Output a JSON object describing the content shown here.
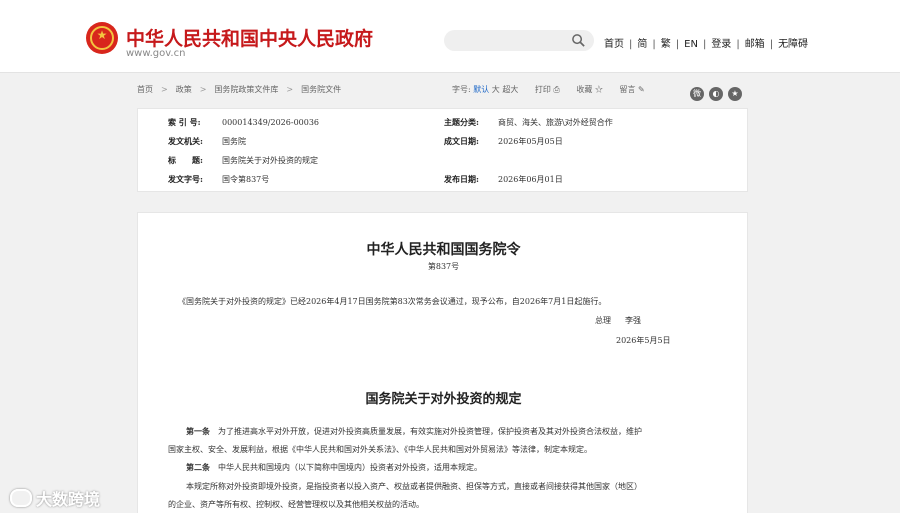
{
  "header": {
    "site_title": "中华人民共和国中央人民政府",
    "site_url": "www.gov.cn",
    "search_placeholder": "",
    "nav": [
      "首页",
      "简",
      "繁",
      "EN",
      "登录",
      "邮箱",
      "无障碍"
    ]
  },
  "breadcrumb": [
    "首页",
    "政策",
    "国务院政策文件库",
    "国务院文件"
  ],
  "tools": {
    "font_label": "字号:",
    "font_default": "默认",
    "font_large": "大",
    "font_xlarge": "超大",
    "print": "打印",
    "favorite": "收藏",
    "comment": "留言"
  },
  "meta": {
    "index_label": "索 引 号:",
    "index_value": "000014349/2026-00036",
    "topic_label": "主题分类:",
    "topic_value": "商贸、海关、旅游\\对外经贸合作",
    "issuer_label": "发文机关:",
    "issuer_value": "国务院",
    "date_label": "成文日期:",
    "date_value": "2026年05月05日",
    "title_label": "标　　题:",
    "title_value": "国务院关于对外投资的规定",
    "docno_label": "发文字号:",
    "docno_value": "国令第837号",
    "pubdate_label": "发布日期:",
    "pubdate_value": "2026年06月01日"
  },
  "doc": {
    "title": "中华人民共和国国务院令",
    "number": "第837号",
    "intro": "《国务院关于对外投资的规定》已经2026年4月17日国务院第83次常务会议通过，现予公布，自2026年7月1日起施行。",
    "signer_title": "总理",
    "signer_name": "李强",
    "sign_date": "2026年5月5日",
    "reg_title": "国务院关于对外投资的规定",
    "art1_label": "第一条",
    "art1_line1": "为了推进高水平对外开放，促进对外投资高质量发展，有效实施对外投资管理，保护投资者及其对外投资合法权益，维护",
    "art1_line2": "国家主权、安全、发展利益，根据《中华人民共和国对外关系法》、《中华人民共和国对外贸易法》等法律，制定本规定。",
    "art2_label": "第二条",
    "art2_line1": "中华人民共和国境内（以下简称中国境内）投资者对外投资，适用本规定。",
    "art2_line2": "本规定所称对外投资即境外投资，是指投资者以投入资产、权益或者提供融资、担保等方式，直接或者间接获得其他国家（地区）",
    "art2_line3": "的企业、资产等所有权、控制权、经营管理权以及其他相关权益的活动。"
  },
  "watermark": "大数跨境"
}
